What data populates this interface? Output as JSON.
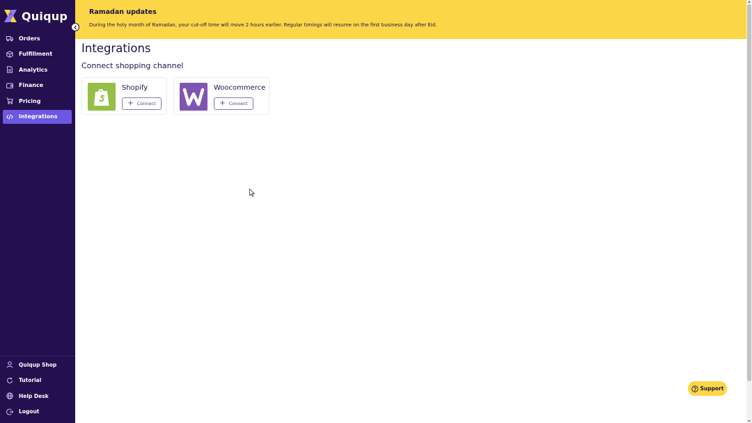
{
  "app": {
    "name": "Quiqup"
  },
  "sidebar": {
    "items": [
      {
        "label": "Orders",
        "icon": "truck-icon"
      },
      {
        "label": "Fulfillment",
        "icon": "box-icon"
      },
      {
        "label": "Analytics",
        "icon": "document-icon"
      },
      {
        "label": "Finance",
        "icon": "wallet-icon"
      },
      {
        "label": "Pricing",
        "icon": "cart-icon"
      },
      {
        "label": "Integrations",
        "icon": "code-icon",
        "active": true
      }
    ],
    "bottom_items": [
      {
        "label": "Quiqup Shop",
        "icon": "user-icon"
      },
      {
        "label": "Tutorial",
        "icon": "refresh-icon"
      },
      {
        "label": "Help Desk",
        "icon": "globe-icon"
      },
      {
        "label": "Logout",
        "icon": "logout-icon"
      }
    ]
  },
  "banner": {
    "title": "Ramadan updates",
    "text": "During the holy month of Ramadan, your cut-off time will move 2 hours earlier. Regular timings will resume on the first business day after Eid."
  },
  "main": {
    "title": "Integrations",
    "section_title": "Connect shopping channel",
    "integrations": [
      {
        "name": "Shopify",
        "button": "Connect",
        "color": "#95bf47"
      },
      {
        "name": "Woocommerce",
        "button": "Connect",
        "color": "#7f54b3"
      }
    ]
  },
  "support": {
    "label": "Support"
  },
  "colors": {
    "sidebar": "#24104f",
    "accent": "#6c57e3",
    "banner": "#fbd747"
  }
}
